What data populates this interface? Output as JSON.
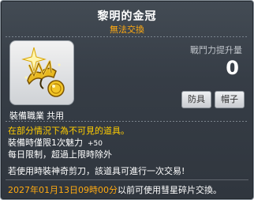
{
  "item": {
    "name": "黎明的金冠",
    "trade_status": "無法交換",
    "job_label": "裝備職業",
    "job_value": "共用",
    "power_label": "戰鬥力提升量",
    "power_value": "0",
    "tags": [
      "防具",
      "帽子"
    ],
    "icon": "golden-crown-icon"
  },
  "description": {
    "line1": "在部分情況下為不可見的道具。",
    "line2_main": "裝備時僅限1次魅力",
    "line2_bonus": "+50",
    "line3": "每日限制，超過上限時除外",
    "line4": "若使用時裝神奇剪刀，該道具可進行一次交易!",
    "expiry_date": "2027年01月13日09時00分",
    "expiry_text": "以前可使用彗星碎片交換。"
  },
  "colors": {
    "warning": "#ffaa11",
    "highlight": "#ffcc00",
    "background": "#363d46"
  }
}
